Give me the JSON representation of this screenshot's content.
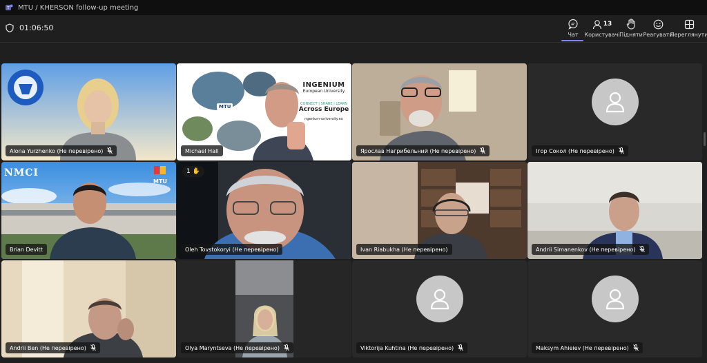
{
  "window": {
    "title": "MTU / KHERSON follow-up meeting"
  },
  "toolbar": {
    "timer": "01:06:50",
    "chat": "Чат",
    "people": "Користувачі",
    "people_count": "13",
    "raise": "Підняти",
    "react": "Реагувати",
    "view": "Переглянути"
  },
  "participants": [
    {
      "name": "Alona Yurzhenko (Не перевірено)"
    },
    {
      "name": "Michael Hall"
    },
    {
      "name": "Ярослав Нагрибельний (Не перевірено)"
    },
    {
      "name": "Ігор Сокол (Не перевірено)"
    },
    {
      "name": "Brian Devitt"
    },
    {
      "name": "Oleh Tovstokoryi (Не перевірено)",
      "raised_hand_order": "1"
    },
    {
      "name": "Ivan Riabukha (Не перевірено)"
    },
    {
      "name": "Andrii Simanenkov (Не перевірено)"
    },
    {
      "name": "Andrii Ben (Не перевірено)"
    },
    {
      "name": "Olya Maryntseva (Не перевірено)"
    },
    {
      "name": "Viktorija Kuhtina (Не перевірено)"
    },
    {
      "name": "Maksym Ahieiev (Не перевірено)"
    }
  ],
  "slide": {
    "brand": "INGENIUM",
    "subtitle": "European University",
    "connect": "CONNECT | SHARE | LEARN",
    "tagline": "Across Europe",
    "url": "ngenium-university.eu",
    "mtu": "MTU"
  },
  "nmci_banner": {
    "text": "NMCI",
    "logo": "MTU"
  },
  "colors": {
    "accent": "#7f85f5",
    "active_outline": "#8d8ce0",
    "background": "#1f1f1f"
  }
}
